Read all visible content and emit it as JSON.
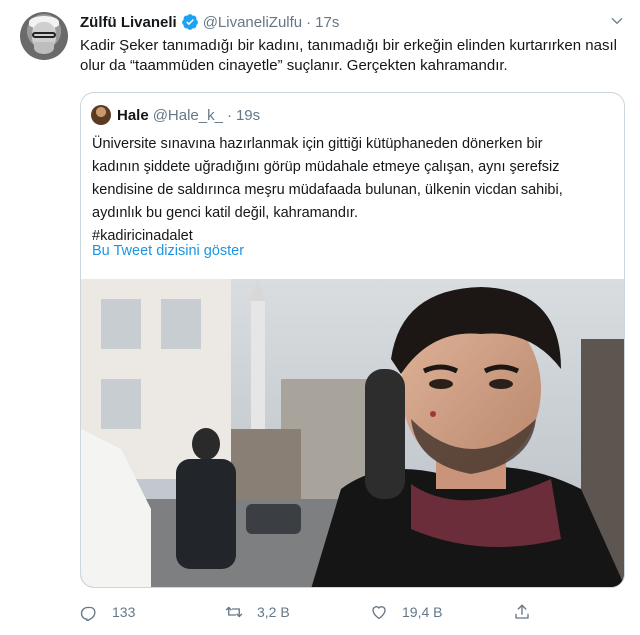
{
  "author": {
    "name": "Zülfü Livaneli",
    "handle": "@LivaneliZulfu",
    "separator": "·",
    "time": "17s"
  },
  "tweet_text": "Kadir Şeker tanımadığı bir kadını, tanımadığı bir erkeğin elinden kurtarırken nasıl olur da “taammüden cinayetle” suçlanır. Gerçekten kahramandır.",
  "quoted": {
    "name": "Hale",
    "handle": "@Hale_k_",
    "separator": "·",
    "time": "19s",
    "text_lines": [
      "Üniversite sınavına hazırlanmak için gittiği kütüphaneden dönerken bir",
      "kadının şiddete uğradığını görüp müdahale etmeye çalışan, aynı şerefsiz",
      "kendisine de saldırınca meşru müdafaada bulunan, ülkenin vicdan sahibi,",
      "aydınlık bu genci katil değil, kahramandır.",
      "#kadiricinadalet"
    ],
    "show_thread": "Bu Tweet dizisini göster"
  },
  "actions": {
    "replies": "133",
    "retweets": "3,2 B",
    "likes": "19,4 B"
  },
  "colors": {
    "text": "#14171a",
    "secondary": "#657786",
    "link": "#1b95e0",
    "verified": "#1da1f2",
    "border": "#ccd6dd"
  },
  "icons": [
    "verified-badge-icon",
    "caret-down-icon",
    "reply-icon",
    "retweet-icon",
    "like-icon",
    "share-icon"
  ]
}
